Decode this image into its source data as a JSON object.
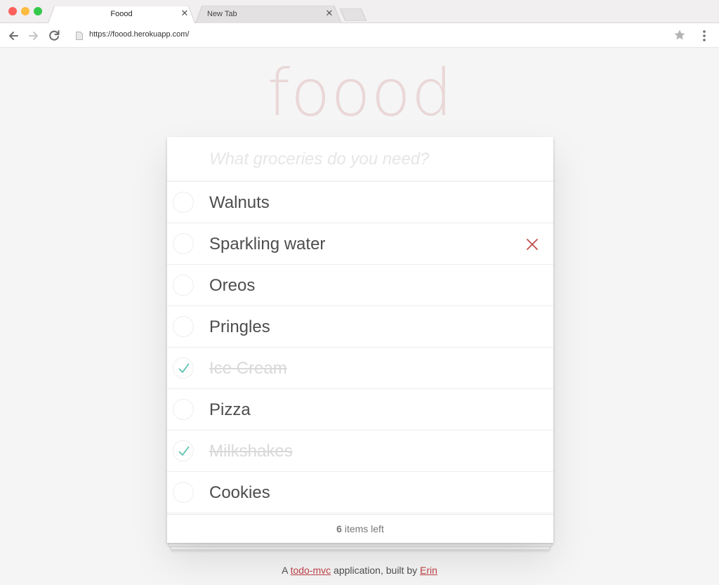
{
  "browser": {
    "tabs": [
      {
        "title": "Foood",
        "active": true
      },
      {
        "title": "New Tab",
        "active": false
      }
    ],
    "url": "https://foood.herokuapp.com/"
  },
  "app": {
    "title": "foood",
    "new_todo_placeholder": "What groceries do you need?",
    "items": [
      {
        "label": "Walnuts",
        "completed": false
      },
      {
        "label": "Sparkling water",
        "completed": false,
        "hovered": true
      },
      {
        "label": "Oreos",
        "completed": false
      },
      {
        "label": "Pringles",
        "completed": false
      },
      {
        "label": "Ice Cream",
        "completed": true
      },
      {
        "label": "Pizza",
        "completed": false
      },
      {
        "label": "Milkshakes",
        "completed": true
      },
      {
        "label": "Cookies",
        "completed": false
      }
    ],
    "footer": {
      "count": "6",
      "count_suffix": " items left"
    },
    "credits": {
      "prefix": "A ",
      "link1": "todo-mvc",
      "middle": " application, built by ",
      "link2": "Erin"
    }
  },
  "colors": {
    "title": "#efd5d5",
    "check": "#5dc2af",
    "destroy": "#cc9a9a",
    "link": "#b83f45"
  },
  "icons": [
    "back-arrow-icon",
    "forward-arrow-icon",
    "reload-icon",
    "page-icon",
    "star-icon",
    "kebab-menu-icon",
    "check-icon",
    "close-icon"
  ]
}
